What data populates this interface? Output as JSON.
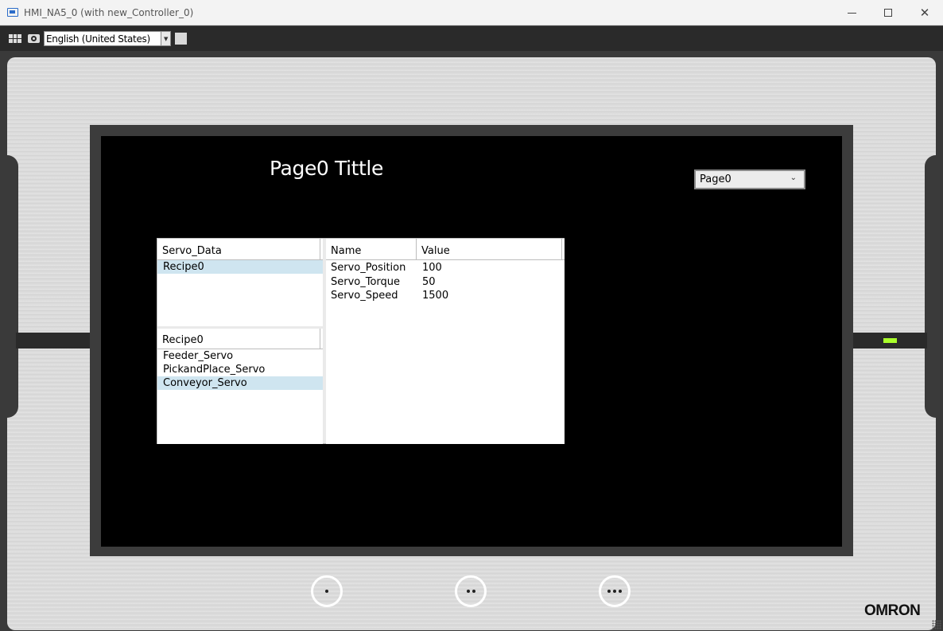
{
  "window": {
    "title": "HMI_NA5_0 (with new_Controller_0)",
    "minimize_label": "—",
    "close_label": "✕"
  },
  "toolbar": {
    "language": "English (United States)"
  },
  "screen": {
    "title": "Page0 Tittle",
    "page_selector": "Page0"
  },
  "recipe": {
    "recipe_list": {
      "header": "Servo_Data",
      "items": [
        "Recipe0"
      ],
      "selected": "Recipe0"
    },
    "ingredient_list": {
      "header": "Recipe0",
      "items": [
        "Feeder_Servo",
        "PickandPlace_Servo",
        "Conveyor_Servo"
      ],
      "selected": "Conveyor_Servo"
    },
    "value_table": {
      "columns": [
        "Name",
        "Value"
      ],
      "rows": [
        {
          "name": "Servo_Position",
          "value": "100"
        },
        {
          "name": "Servo_Torque",
          "value": "50"
        },
        {
          "name": "Servo_Speed",
          "value": "1500"
        }
      ]
    }
  },
  "hardware": {
    "brand": "OMRON",
    "led_color": "#a9ff2a"
  },
  "colors": {
    "selection": "#cfe5f0",
    "screen_bg": "#000000"
  }
}
